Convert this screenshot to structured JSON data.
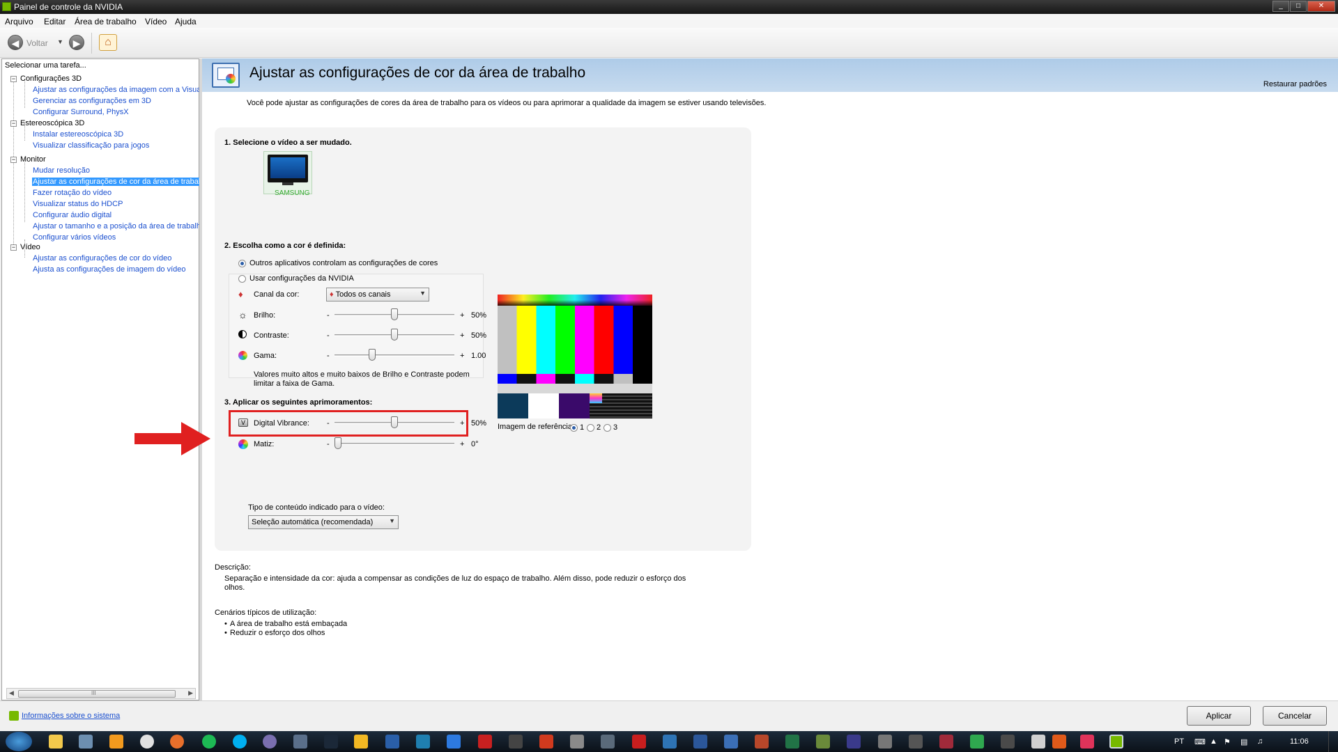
{
  "window": {
    "title": "Painel de controle da NVIDIA",
    "controls": [
      "_",
      "□",
      "✕"
    ]
  },
  "menu": [
    "Arquivo",
    "Editar",
    "Área de trabalho",
    "Vídeo",
    "Ajuda"
  ],
  "toolbar": {
    "back_label": "Voltar"
  },
  "sidebar": {
    "header": "Selecionar uma tarefa...",
    "groups": [
      {
        "label": "Configurações 3D",
        "items": [
          "Ajustar as configurações da imagem com a Visuali",
          "Gerenciar as configurações em 3D",
          "Configurar Surround, PhysX"
        ]
      },
      {
        "label": "Estereoscópica 3D",
        "items": [
          "Instalar estereoscópica 3D",
          "Visualizar classificação para jogos"
        ]
      },
      {
        "label": "Monitor",
        "items": [
          "Mudar resolução",
          "Ajustar as configurações de cor da área de trabal",
          "Fazer rotação do vídeo",
          "Visualizar status do HDCP",
          "Configurar áudio digital",
          "Ajustar o tamanho e a posição da área de trabalh",
          "Configurar vários vídeos"
        ]
      },
      {
        "label": "Vídeo",
        "items": [
          "Ajustar as configurações de cor do vídeo",
          "Ajusta as configurações de imagem do vídeo"
        ]
      }
    ],
    "selected": "Ajustar as configurações de cor da área de trabal",
    "scroll_marker": "III"
  },
  "page": {
    "title": "Ajustar as configurações de cor da área de trabalho",
    "restore_label": "Restaurar padrões",
    "intro": "Você pode ajustar as configurações de cores da área de trabalho para os vídeos ou para aprimorar a qualidade da imagem se estiver usando televisões."
  },
  "step1": {
    "heading": "1. Selecione o vídeo a ser mudado.",
    "display_name": "SAMSUNG"
  },
  "step2": {
    "heading": "2. Escolha como a cor é definida:",
    "option_other": "Outros aplicativos controlam as configurações de cores",
    "option_nvidia": "Usar configurações da NVIDIA",
    "selected_option": "other",
    "channel_label": "Canal da cor:",
    "channel_value": "Todos os canais",
    "brightness": {
      "label": "Brilho:",
      "value": "50%",
      "level": 0.5
    },
    "contrast": {
      "label": "Contraste:",
      "value": "50%",
      "level": 0.5
    },
    "gamma": {
      "label": "Gama:",
      "value": "1.00",
      "level": 0.3
    },
    "minus": "-",
    "plus": "+",
    "note": "Valores muito altos e muito baixos de Brilho e Contraste podem limitar a faixa de Gama."
  },
  "step3": {
    "heading": "3. Aplicar os seguintes aprimoramentos:",
    "vibrance": {
      "label": "Digital Vibrance:",
      "value": "50%",
      "level": 0.5
    },
    "hue": {
      "label": "Matiz:",
      "value": "0°",
      "level": 0.0
    },
    "content_type_label": "Tipo de conteúdo indicado para o vídeo:",
    "content_type_value": "Seleção automática (recomendada)"
  },
  "reference": {
    "label": "Imagem de referência:",
    "options": [
      "1",
      "2",
      "3"
    ],
    "selected": "1"
  },
  "description": {
    "heading": "Descrição:",
    "text": "Separação e intensidade da cor: ajuda a compensar as condições de luz do espaço de trabalho. Além disso, pode reduzir o esforço dos olhos."
  },
  "scenarios": {
    "heading": "Cenários típicos de utilização:",
    "items": [
      "A área de trabalho está embaçada",
      "Reduzir o esforço dos olhos"
    ]
  },
  "footer": {
    "system_info": "Informações sobre o sistema",
    "apply": "Aplicar",
    "cancel": "Cancelar"
  },
  "taskbar": {
    "lang": "PT",
    "time": "11:06"
  },
  "colors": {
    "highlight": "#e02020",
    "nvidia_green": "#76b900",
    "link": "#1a4fcf",
    "selection": "#3399ff"
  }
}
